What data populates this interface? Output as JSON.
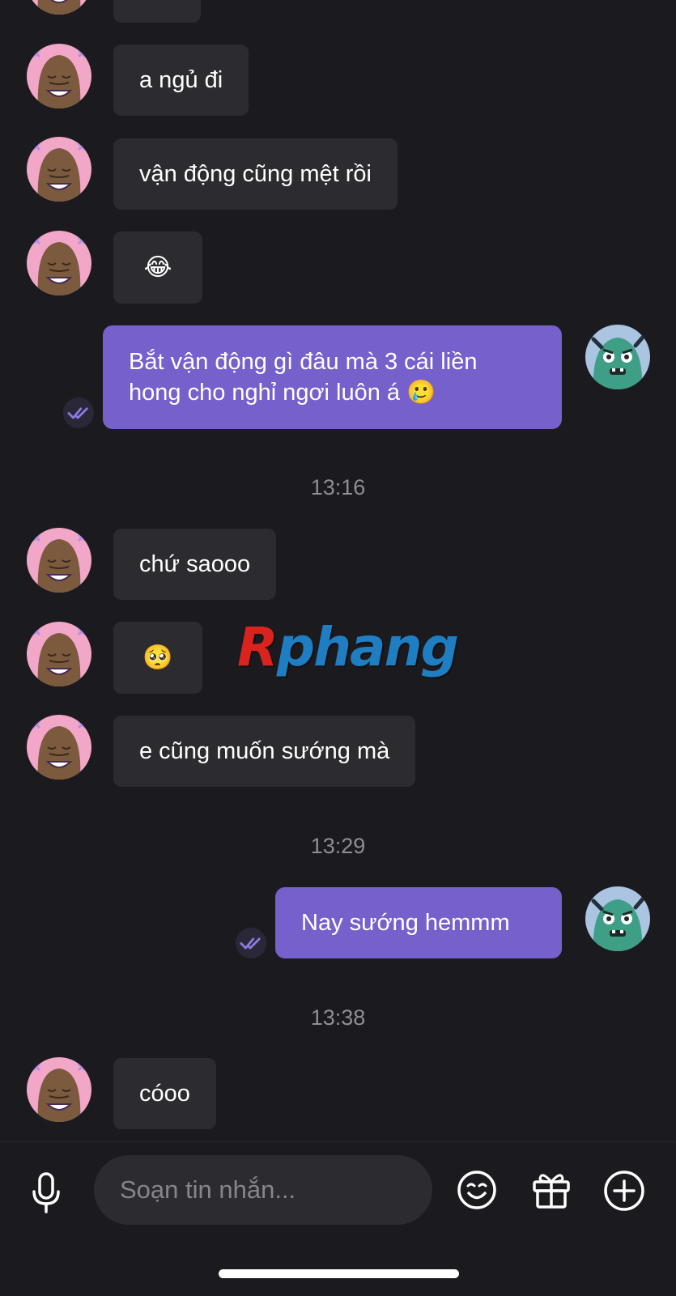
{
  "messages": [
    {
      "id": "m1",
      "text": "a ngủ đi"
    },
    {
      "id": "m2",
      "text": "vận động cũng mệt rồi"
    },
    {
      "id": "m3",
      "text": "😂"
    },
    {
      "id": "m4",
      "text": "Bắt vận động gì đâu mà 3 cái liền hong cho nghỉ ngơi luôn á 🥲"
    },
    {
      "id": "m5",
      "text": "chứ saooo"
    },
    {
      "id": "m6",
      "text": "🥺"
    },
    {
      "id": "m7",
      "text": "e cũng muốn sướng mà"
    },
    {
      "id": "m8",
      "text": "Nay sướng hemmm"
    },
    {
      "id": "m9",
      "text": "cóoo"
    }
  ],
  "timestamps": [
    "13:16",
    "13:29",
    "13:38"
  ],
  "watermark": {
    "first": "R",
    "rest": "phang"
  },
  "composer": {
    "placeholder": "Soạn tin nhắn..."
  },
  "icons": {
    "mic": "microphone-icon",
    "emoji": "smiley-icon",
    "gift": "gift-icon",
    "add": "plus-circle-icon",
    "seen": "double-check-icon"
  },
  "colors": {
    "background": "#1b1b1f",
    "incoming_bubble": "#2c2c30",
    "outgoing_bubble": "#7660cc",
    "timestamp": "#8e8e93"
  }
}
